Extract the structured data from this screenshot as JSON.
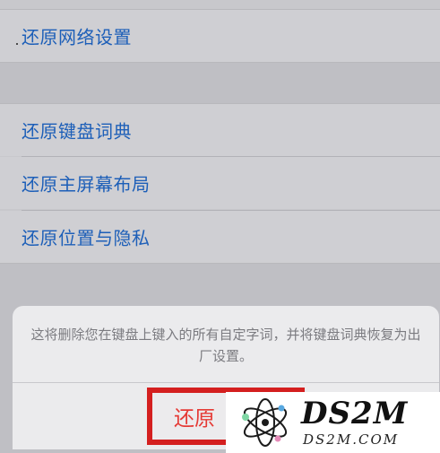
{
  "settings": {
    "items": [
      {
        "label": "还原网络设置"
      },
      {
        "label": "还原键盘词典"
      },
      {
        "label": "还原主屏幕布局"
      },
      {
        "label": "还原位置与隐私"
      }
    ]
  },
  "sheet": {
    "message": "这将删除您在键盘上键入的所有自定字词，并将键盘词典恢复为出厂设置。",
    "reset_label": "还原"
  },
  "watermark": {
    "big": "DS2M",
    "small": "DS2M.COM"
  },
  "colors": {
    "accent": "#1d5fb8",
    "destructive": "#e53a35",
    "highlight_box": "#d41f1f"
  }
}
